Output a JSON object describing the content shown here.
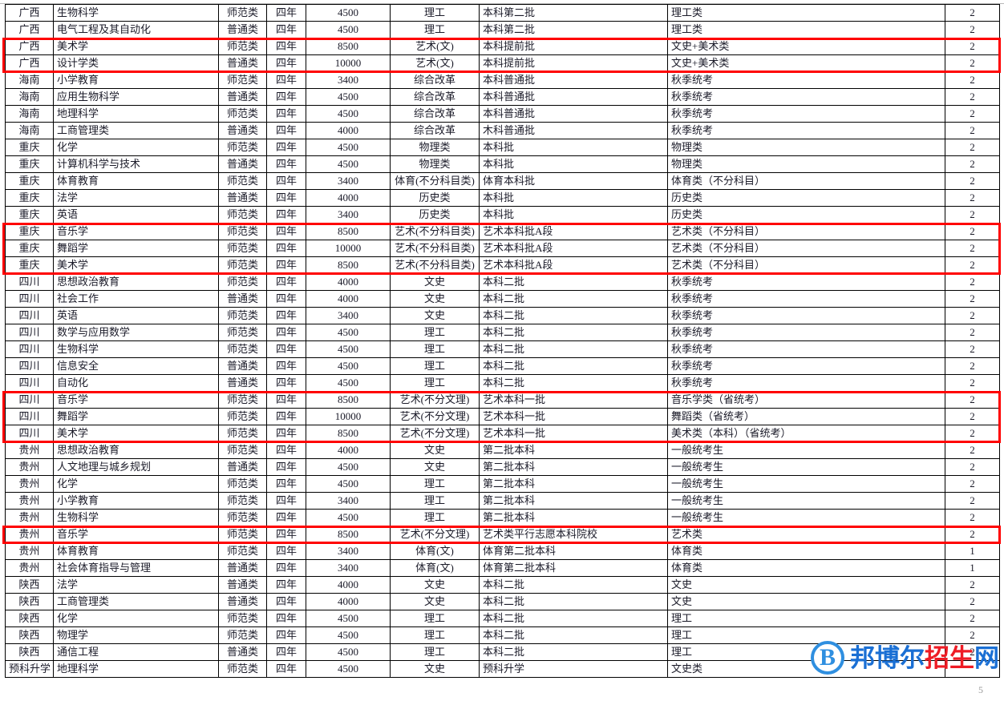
{
  "table": {
    "columns": [
      {
        "key": "province",
        "class": "c-prov"
      },
      {
        "key": "major",
        "class": "c-major"
      },
      {
        "key": "category",
        "class": "c-type"
      },
      {
        "key": "duration",
        "class": "c-years"
      },
      {
        "key": "tuition",
        "class": "c-fee"
      },
      {
        "key": "subject",
        "class": "c-subj"
      },
      {
        "key": "batch",
        "class": "c-batch"
      },
      {
        "key": "exam_category",
        "class": "c-cat"
      },
      {
        "key": "count",
        "class": "c-count"
      }
    ],
    "rows": [
      {
        "province": "广西",
        "major": "生物科学",
        "category": "师范类",
        "duration": "四年",
        "tuition": "4500",
        "subject": "理工",
        "batch": "本科第二批",
        "exam_category": "理工类",
        "count": "2",
        "highlight": false
      },
      {
        "province": "广西",
        "major": "电气工程及其自动化",
        "category": "普通类",
        "duration": "四年",
        "tuition": "4500",
        "subject": "理工",
        "batch": "本科第二批",
        "exam_category": "理工类",
        "count": "2",
        "highlight": false
      },
      {
        "province": "广西",
        "major": "美术学",
        "category": "师范类",
        "duration": "四年",
        "tuition": "8500",
        "subject": "艺术(文)",
        "batch": "本科提前批",
        "exam_category": "文史+美术类",
        "count": "2",
        "highlight": true
      },
      {
        "province": "广西",
        "major": "设计学类",
        "category": "普通类",
        "duration": "四年",
        "tuition": "10000",
        "subject": "艺术(文)",
        "batch": "本科提前批",
        "exam_category": "文史+美术类",
        "count": "2",
        "highlight": true
      },
      {
        "province": "海南",
        "major": "小学教育",
        "category": "师范类",
        "duration": "四年",
        "tuition": "3400",
        "subject": "综合改革",
        "batch": "本科普通批",
        "exam_category": "秋季统考",
        "count": "2",
        "highlight": false
      },
      {
        "province": "海南",
        "major": "应用生物科学",
        "category": "普通类",
        "duration": "四年",
        "tuition": "4500",
        "subject": "综合改革",
        "batch": "本科普通批",
        "exam_category": "秋季统考",
        "count": "2",
        "highlight": false
      },
      {
        "province": "海南",
        "major": "地理科学",
        "category": "师范类",
        "duration": "四年",
        "tuition": "4500",
        "subject": "综合改革",
        "batch": "本科普通批",
        "exam_category": "秋季统考",
        "count": "2",
        "highlight": false
      },
      {
        "province": "海南",
        "major": "工商管理类",
        "category": "普通类",
        "duration": "四年",
        "tuition": "4000",
        "subject": "综合改革",
        "batch": "木科普通批",
        "exam_category": "秋季统考",
        "count": "2",
        "highlight": false
      },
      {
        "province": "重庆",
        "major": "化学",
        "category": "师范类",
        "duration": "四年",
        "tuition": "4500",
        "subject": "物理类",
        "batch": "本科批",
        "exam_category": "物理类",
        "count": "2",
        "highlight": false
      },
      {
        "province": "重庆",
        "major": "计算机科学与技术",
        "category": "普通类",
        "duration": "四年",
        "tuition": "4500",
        "subject": "物理类",
        "batch": "本科批",
        "exam_category": "物理类",
        "count": "2",
        "highlight": false
      },
      {
        "province": "重庆",
        "major": "体育教育",
        "category": "师范类",
        "duration": "四年",
        "tuition": "3400",
        "subject": "体育(不分科目类)",
        "batch": "体育本科批",
        "exam_category": "体育类（不分科目）",
        "count": "2",
        "highlight": false
      },
      {
        "province": "重庆",
        "major": "法学",
        "category": "普通类",
        "duration": "四年",
        "tuition": "4000",
        "subject": "历史类",
        "batch": "本科批",
        "exam_category": "历史类",
        "count": "2",
        "highlight": false
      },
      {
        "province": "重庆",
        "major": "英语",
        "category": "师范类",
        "duration": "四年",
        "tuition": "3400",
        "subject": "历史类",
        "batch": "本科批",
        "exam_category": "历史类",
        "count": "2",
        "highlight": false
      },
      {
        "province": "重庆",
        "major": "音乐学",
        "category": "师范类",
        "duration": "四年",
        "tuition": "8500",
        "subject": "艺术(不分科目类)",
        "batch": "艺术本科批A段",
        "exam_category": "艺术类（不分科目）",
        "count": "2",
        "highlight": true
      },
      {
        "province": "重庆",
        "major": "舞蹈学",
        "category": "师范类",
        "duration": "四年",
        "tuition": "10000",
        "subject": "艺术(不分科目类)",
        "batch": "艺术本科批A段",
        "exam_category": "艺术类（不分科目）",
        "count": "2",
        "highlight": true
      },
      {
        "province": "重庆",
        "major": "美术学",
        "category": "师范类",
        "duration": "四年",
        "tuition": "8500",
        "subject": "艺术(不分科目类)",
        "batch": "艺术本科批A段",
        "exam_category": "艺术类（不分科目）",
        "count": "2",
        "highlight": true
      },
      {
        "province": "四川",
        "major": "思想政治教育",
        "category": "师范类",
        "duration": "四年",
        "tuition": "4000",
        "subject": "文史",
        "batch": "本科二批",
        "exam_category": "秋季统考",
        "count": "2",
        "highlight": false
      },
      {
        "province": "四川",
        "major": "社会工作",
        "category": "普通类",
        "duration": "四年",
        "tuition": "4000",
        "subject": "文史",
        "batch": "本科二批",
        "exam_category": "秋季统考",
        "count": "2",
        "highlight": false
      },
      {
        "province": "四川",
        "major": "英语",
        "category": "师范类",
        "duration": "四年",
        "tuition": "3400",
        "subject": "文史",
        "batch": "本科二批",
        "exam_category": "秋季统考",
        "count": "2",
        "highlight": false
      },
      {
        "province": "四川",
        "major": "数学与应用数学",
        "category": "师范类",
        "duration": "四年",
        "tuition": "4500",
        "subject": "理工",
        "batch": "本科二批",
        "exam_category": "秋季统考",
        "count": "2",
        "highlight": false
      },
      {
        "province": "四川",
        "major": "生物科学",
        "category": "师范类",
        "duration": "四年",
        "tuition": "4500",
        "subject": "理工",
        "batch": "本科二批",
        "exam_category": "秋季统考",
        "count": "2",
        "highlight": false
      },
      {
        "province": "四川",
        "major": "信息安全",
        "category": "普通类",
        "duration": "四年",
        "tuition": "4500",
        "subject": "理工",
        "batch": "本科二批",
        "exam_category": "秋季统考",
        "count": "2",
        "highlight": false
      },
      {
        "province": "四川",
        "major": "自动化",
        "category": "普通类",
        "duration": "四年",
        "tuition": "4500",
        "subject": "理工",
        "batch": "本科二批",
        "exam_category": "秋季统考",
        "count": "2",
        "highlight": false
      },
      {
        "province": "四川",
        "major": "音乐学",
        "category": "师范类",
        "duration": "四年",
        "tuition": "8500",
        "subject": "艺术(不分文理)",
        "batch": "艺术本科一批",
        "exam_category": "音乐学类（省统考）",
        "count": "2",
        "highlight": true
      },
      {
        "province": "四川",
        "major": "舞蹈学",
        "category": "师范类",
        "duration": "四年",
        "tuition": "10000",
        "subject": "艺术(不分文理)",
        "batch": "艺术本科一批",
        "exam_category": "舞蹈类（省统考）",
        "count": "2",
        "highlight": true
      },
      {
        "province": "四川",
        "major": "美术学",
        "category": "师范类",
        "duration": "四年",
        "tuition": "8500",
        "subject": "艺术(不分文理)",
        "batch": "艺术本科一批",
        "exam_category": "美术类（本科）（省统考）",
        "count": "2",
        "highlight": true
      },
      {
        "province": "贵州",
        "major": "思想政治教育",
        "category": "师范类",
        "duration": "四年",
        "tuition": "4000",
        "subject": "文史",
        "batch": "第二批本科",
        "exam_category": "一般统考生",
        "count": "2",
        "highlight": false
      },
      {
        "province": "贵州",
        "major": "人文地理与城乡规划",
        "category": "普通类",
        "duration": "四年",
        "tuition": "4500",
        "subject": "文史",
        "batch": "第二批本科",
        "exam_category": "一般统考生",
        "count": "2",
        "highlight": false
      },
      {
        "province": "贵州",
        "major": "化学",
        "category": "师范类",
        "duration": "四年",
        "tuition": "4500",
        "subject": "理工",
        "batch": "第二批本科",
        "exam_category": "一般统考生",
        "count": "2",
        "highlight": false
      },
      {
        "province": "贵州",
        "major": "小学教育",
        "category": "师范类",
        "duration": "四年",
        "tuition": "3400",
        "subject": "理工",
        "batch": "第二批本科",
        "exam_category": "一般统考生",
        "count": "2",
        "highlight": false
      },
      {
        "province": "贵州",
        "major": "生物科学",
        "category": "师范类",
        "duration": "四年",
        "tuition": "4500",
        "subject": "理工",
        "batch": "第二批本科",
        "exam_category": "一般统考生",
        "count": "2",
        "highlight": false
      },
      {
        "province": "贵州",
        "major": "音乐学",
        "category": "师范类",
        "duration": "四年",
        "tuition": "8500",
        "subject": "艺术(不分文理)",
        "batch": "艺术类平行志愿本科院校",
        "exam_category": "艺术类",
        "count": "2",
        "highlight": true
      },
      {
        "province": "贵州",
        "major": "体育教育",
        "category": "师范类",
        "duration": "四年",
        "tuition": "3400",
        "subject": "体育(文)",
        "batch": "体育第二批本科",
        "exam_category": "体育类",
        "count": "1",
        "highlight": false
      },
      {
        "province": "贵州",
        "major": "社会体育指导与管理",
        "category": "普通类",
        "duration": "四年",
        "tuition": "3400",
        "subject": "体育(文)",
        "batch": "体育第二批本科",
        "exam_category": "体育类",
        "count": "1",
        "highlight": false
      },
      {
        "province": "陕西",
        "major": "法学",
        "category": "普通类",
        "duration": "四年",
        "tuition": "4000",
        "subject": "文史",
        "batch": "本科二批",
        "exam_category": "文史",
        "count": "2",
        "highlight": false
      },
      {
        "province": "陕西",
        "major": "工商管理类",
        "category": "普通类",
        "duration": "四年",
        "tuition": "4000",
        "subject": "文史",
        "batch": "本科二批",
        "exam_category": "文史",
        "count": "2",
        "highlight": false
      },
      {
        "province": "陕西",
        "major": "化学",
        "category": "师范类",
        "duration": "四年",
        "tuition": "4500",
        "subject": "理工",
        "batch": "本科二批",
        "exam_category": "理工",
        "count": "2",
        "highlight": false
      },
      {
        "province": "陕西",
        "major": "物理学",
        "category": "师范类",
        "duration": "四年",
        "tuition": "4500",
        "subject": "理工",
        "batch": "本科二批",
        "exam_category": "理工",
        "count": "2",
        "highlight": false
      },
      {
        "province": "陕西",
        "major": "通信工程",
        "category": "普通类",
        "duration": "四年",
        "tuition": "4500",
        "subject": "理工",
        "batch": "本科二批",
        "exam_category": "理工",
        "count": "2",
        "highlight": false
      },
      {
        "province": "预科升学",
        "major": "地理科学",
        "category": "师范类",
        "duration": "四年",
        "tuition": "4500",
        "subject": "文史",
        "batch": "预科升学",
        "exam_category": "文史类",
        "count": "",
        "highlight": false
      }
    ]
  },
  "highlight_color": "#ff0000",
  "watermark": {
    "badge_letter": "B",
    "text_part1": "邦博尔",
    "text_part2": "招生",
    "text_part3": "网",
    "color_blue": "#1a6fd4",
    "color_red": "#ee1c25"
  },
  "page_number": "5"
}
